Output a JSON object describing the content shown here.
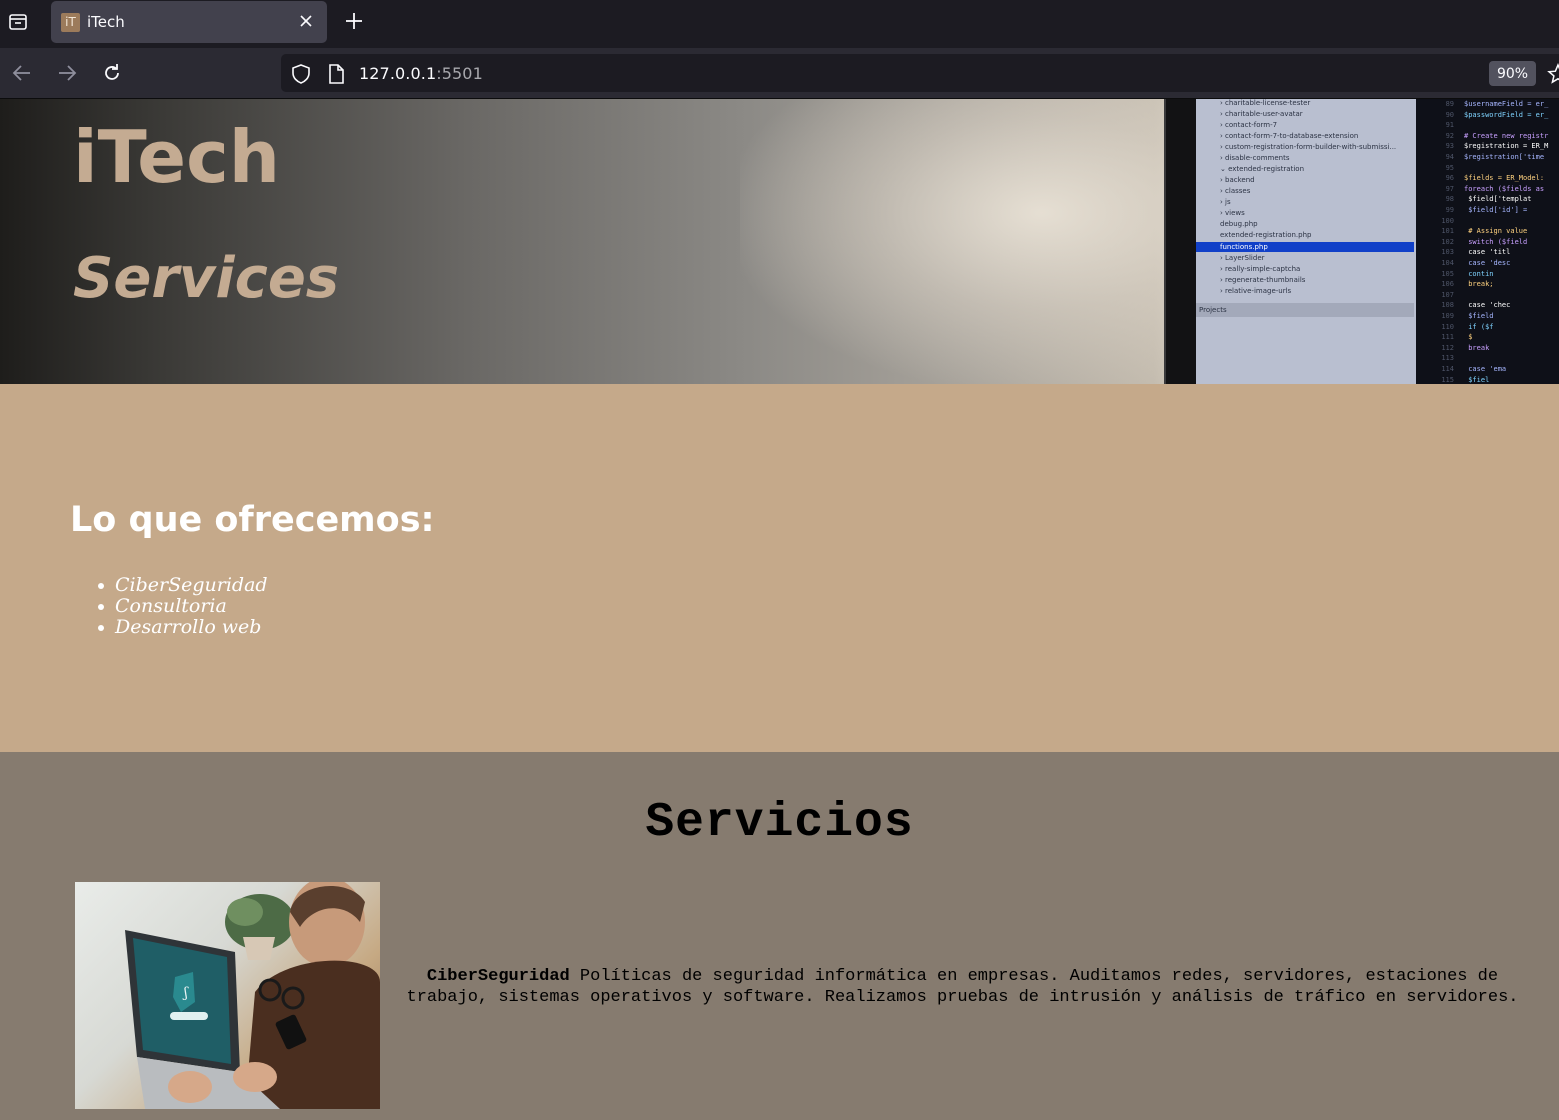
{
  "browser": {
    "tab_title": "iTech",
    "favicon_text": "iT",
    "url_host": "127.0.0.1",
    "url_port": ":5501",
    "zoom": "90%"
  },
  "hero": {
    "brand": "iTech",
    "subtitle": "Services",
    "panel_items": [
      "› charitable-license-tester",
      "› charitable-user-avatar",
      "› contact-form-7",
      "› contact-form-7-to-database-extension",
      "› custom-registration-form-builder-with-submissi...",
      "› disable-comments",
      "⌄ extended-registration",
      "  › backend",
      "  › classes",
      "  › js",
      "  › views",
      "  debug.php",
      "  extended-registration.php",
      "  functions.php",
      "› LayerSlider",
      "› really-simple-captcha",
      "› regenerate-thumbnails",
      "› relative-image-urls"
    ],
    "panel_footer": "Projects",
    "code_lines": [
      {
        "n": "89",
        "t": "$usernameField = er_"
      },
      {
        "n": "90",
        "t": "$passwordField = er_"
      },
      {
        "n": "91",
        "t": ""
      },
      {
        "n": "92",
        "t": "# Create new registr"
      },
      {
        "n": "93",
        "t": "$registration = ER_M"
      },
      {
        "n": "94",
        "t": "$registration['time"
      },
      {
        "n": "95",
        "t": ""
      },
      {
        "n": "96",
        "t": "$fields = ER_Model:"
      },
      {
        "n": "97",
        "t": "foreach ($fields as"
      },
      {
        "n": "98",
        "t": "  $field['templat"
      },
      {
        "n": "99",
        "t": "  $field['id'] ="
      },
      {
        "n": "100",
        "t": ""
      },
      {
        "n": "101",
        "t": "  # Assign value"
      },
      {
        "n": "102",
        "t": "  switch ($field"
      },
      {
        "n": "103",
        "t": "    case 'titl"
      },
      {
        "n": "104",
        "t": "    case 'desc"
      },
      {
        "n": "105",
        "t": "      contin"
      },
      {
        "n": "106",
        "t": "      break;"
      },
      {
        "n": "107",
        "t": ""
      },
      {
        "n": "108",
        "t": "    case 'chec"
      },
      {
        "n": "109",
        "t": "      $field"
      },
      {
        "n": "110",
        "t": "      if ($f"
      },
      {
        "n": "111",
        "t": "        $"
      },
      {
        "n": "112",
        "t": "      break"
      },
      {
        "n": "113",
        "t": ""
      },
      {
        "n": "114",
        "t": "    case 'ema"
      },
      {
        "n": "115",
        "t": "      $fiel"
      }
    ]
  },
  "offer": {
    "title": "Lo que ofrecemos:",
    "items": [
      "CiberSeguridad",
      "Consultoria",
      "Desarrollo web"
    ]
  },
  "services": {
    "title": "Servicios",
    "items": [
      {
        "name": "CiberSeguridad",
        "description": " Políticas de seguridad informática en empresas. Auditamos redes, servidores, estaciones de trabajo, sistemas operativos y software. Realizamos pruebas de intrusión y análisis de tráfico en servidores."
      }
    ]
  }
}
